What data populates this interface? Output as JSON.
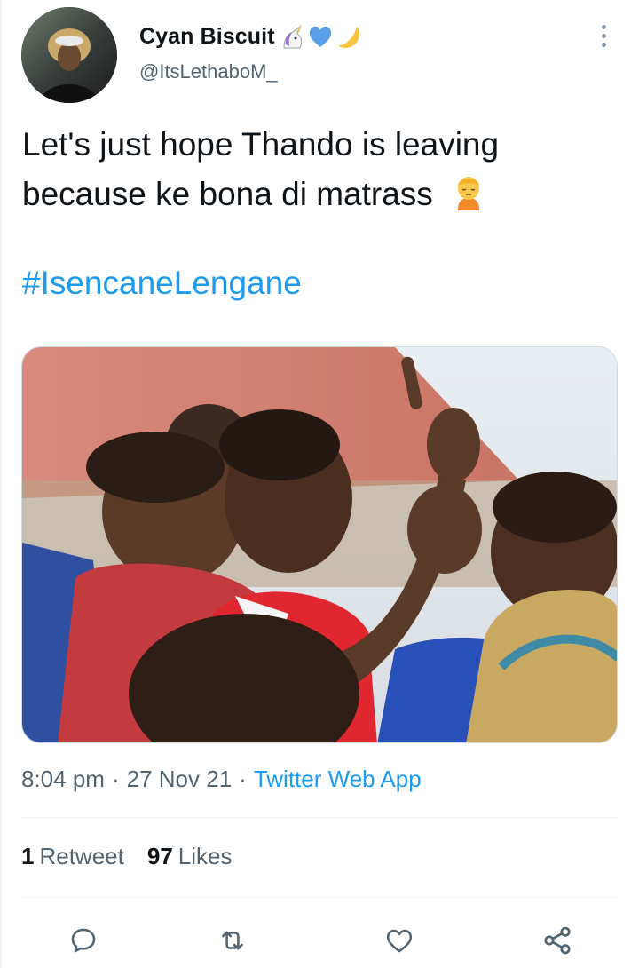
{
  "colors": {
    "accent": "#1d9bf0",
    "text_primary": "#0f1419",
    "text_secondary": "#536471",
    "divider": "#eff3f4"
  },
  "author": {
    "display_name": "Cyan Biscuit",
    "handle": "@ItsLethaboM_",
    "badges": [
      "unicorn-emoji-icon",
      "blue-heart-emoji-icon",
      "crescent-moon-emoji-icon"
    ]
  },
  "tweet": {
    "text_line1": "Let's just hope Thando is leaving",
    "text_line2": "because ke bona di matrass",
    "text_emoji": "person-bowing-emoji-icon",
    "hashtag": "#IsencaneLengane"
  },
  "meta": {
    "time": "8:04 pm",
    "date": "27 Nov 21",
    "separator": "·",
    "source": "Twitter Web App"
  },
  "stats": {
    "retweet_count": "1",
    "retweet_label": "Retweet",
    "like_count": "97",
    "like_label": "Likes"
  },
  "actions": [
    "reply-icon",
    "retweet-icon",
    "like-icon",
    "share-icon"
  ]
}
